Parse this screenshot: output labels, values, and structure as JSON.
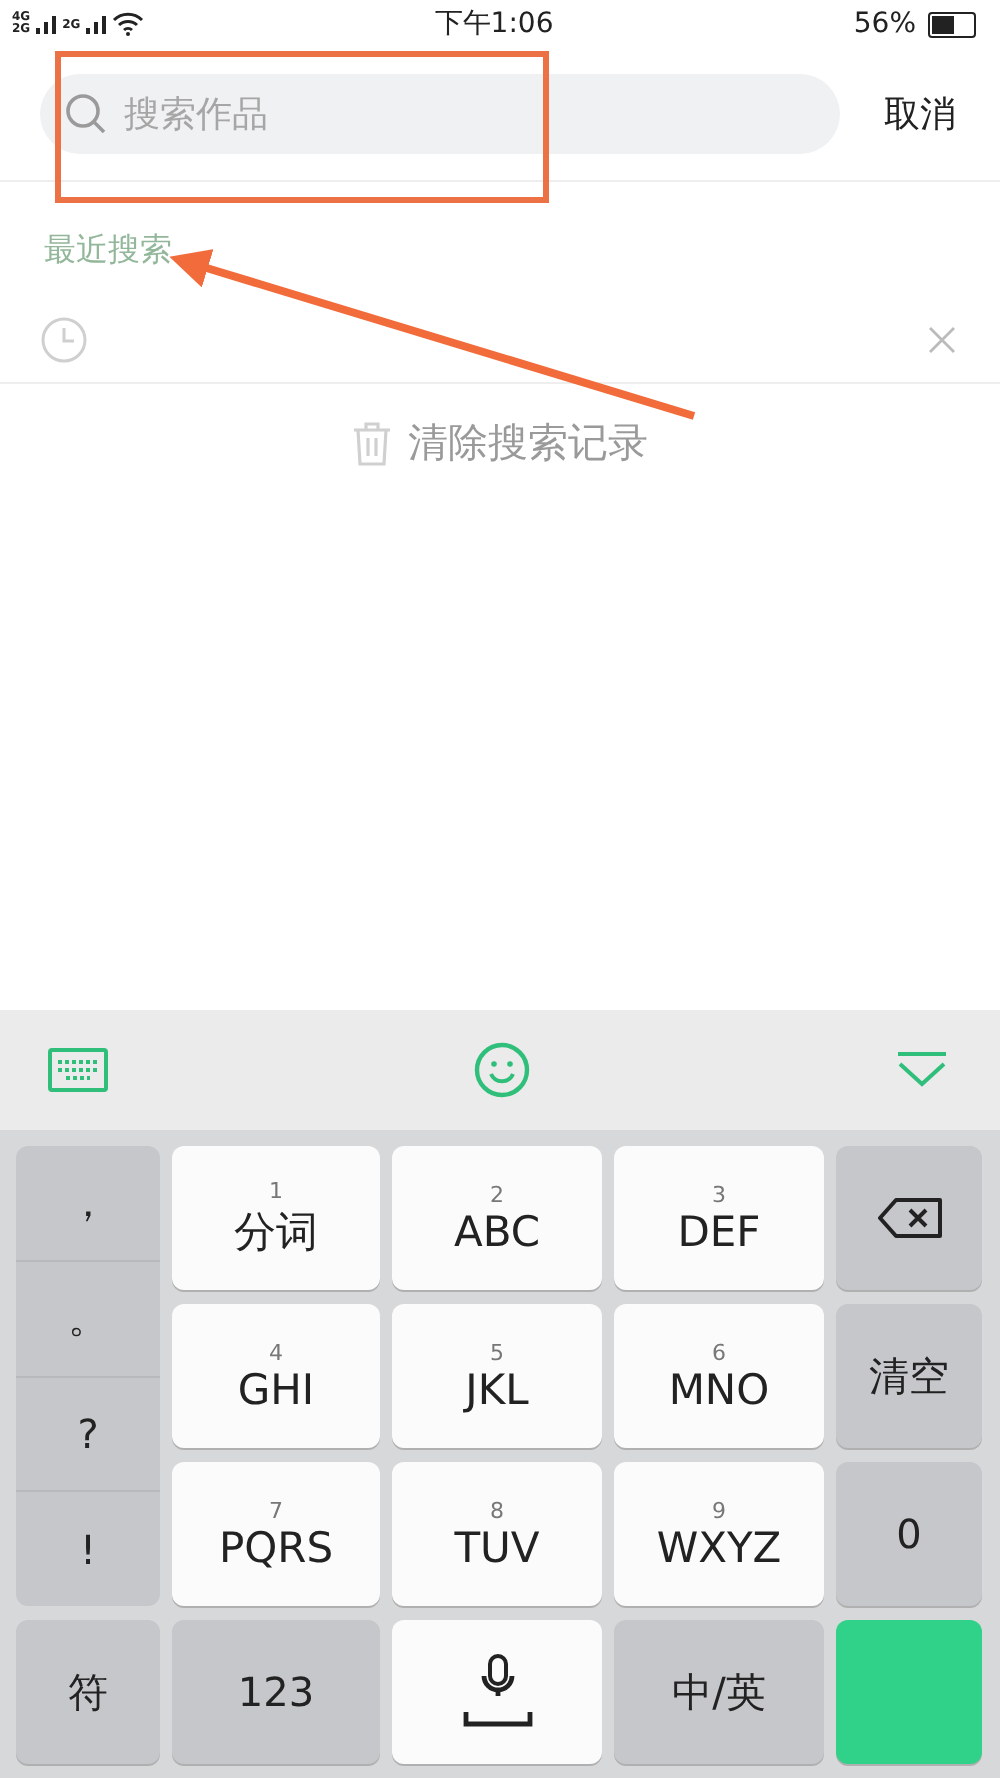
{
  "status_bar": {
    "network_labels": [
      "4G",
      "2G",
      "2G"
    ],
    "time": "下午1:06",
    "battery": "56%"
  },
  "search": {
    "placeholder": "搜索作品",
    "cancel": "取消"
  },
  "recent": {
    "title": "最近搜索",
    "items": [
      {
        "kind": "history"
      }
    ],
    "clear": "清除搜索记录"
  },
  "keyboard": {
    "symbols": [
      "，",
      "。",
      "?",
      "!"
    ],
    "keys": [
      {
        "kind": "letter",
        "number": "1",
        "label": "分词"
      },
      {
        "kind": "letter",
        "number": "2",
        "label": "ABC"
      },
      {
        "kind": "letter",
        "number": "3",
        "label": "DEF"
      },
      {
        "kind": "delete"
      },
      {
        "kind": "letter",
        "number": "4",
        "label": "GHI"
      },
      {
        "kind": "letter",
        "number": "5",
        "label": "JKL"
      },
      {
        "kind": "letter",
        "number": "6",
        "label": "MNO"
      },
      {
        "kind": "function",
        "label": "清空"
      },
      {
        "kind": "letter",
        "number": "7",
        "label": "PQRS"
      },
      {
        "kind": "letter",
        "number": "8",
        "label": "TUV"
      },
      {
        "kind": "letter",
        "number": "9",
        "label": "WXYZ"
      },
      {
        "kind": "function",
        "label": "0"
      },
      {
        "kind": "function",
        "label": "符"
      },
      {
        "kind": "function",
        "label": "123"
      },
      {
        "kind": "space"
      },
      {
        "kind": "function",
        "label": "中/英"
      },
      {
        "kind": "action"
      }
    ]
  },
  "annotations": {
    "highlight_box": true,
    "arrow": true
  }
}
